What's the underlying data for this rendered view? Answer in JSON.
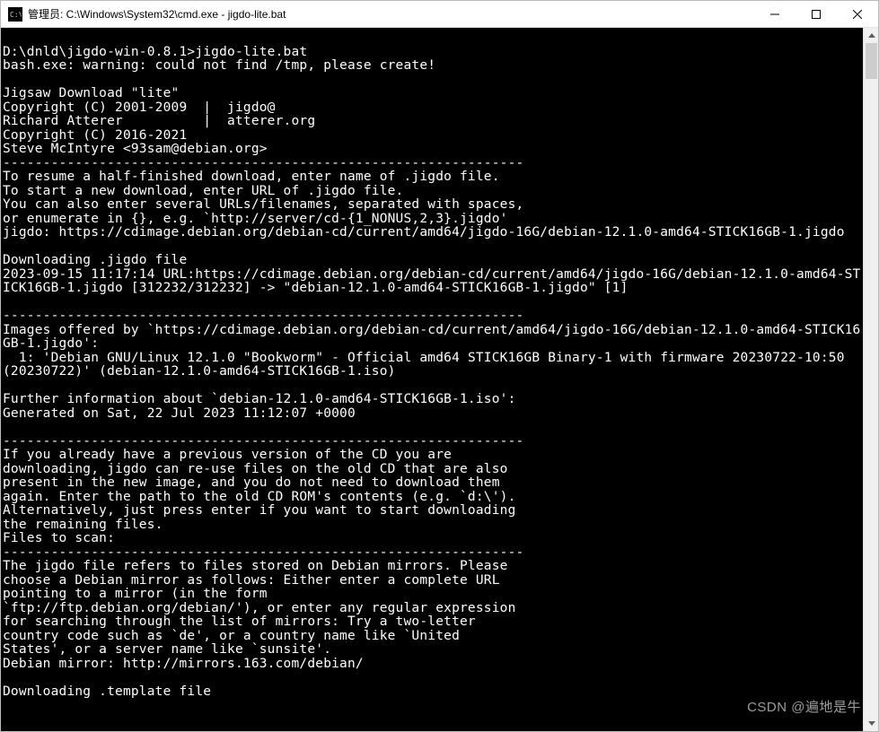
{
  "titlebar": {
    "icon_text": "C:\\",
    "title": "管理员: C:\\Windows\\System32\\cmd.exe - jigdo-lite.bat"
  },
  "console_text": "\nD:\\dnld\\jigdo-win-0.8.1>jigdo-lite.bat\nbash.exe: warning: could not find /tmp, please create!\n\nJigsaw Download \"lite\"\nCopyright (C) 2001-2009  |  jigdo@\nRichard Atterer          |  atterer.org\nCopyright (C) 2016-2021\nSteve McIntyre <93sam@debian.org>\n-----------------------------------------------------------------\nTo resume a half-finished download, enter name of .jigdo file.\nTo start a new download, enter URL of .jigdo file.\nYou can also enter several URLs/filenames, separated with spaces,\nor enumerate in {}, e.g. `http://server/cd-{1_NONUS,2,3}.jigdo'\njigdo: https://cdimage.debian.org/debian-cd/current/amd64/jigdo-16G/debian-12.1.0-amd64-STICK16GB-1.jigdo\n\nDownloading .jigdo file\n2023-09-15 11:17:14 URL:https://cdimage.debian.org/debian-cd/current/amd64/jigdo-16G/debian-12.1.0-amd64-STICK16GB-1.jigdo [312232/312232] -> \"debian-12.1.0-amd64-STICK16GB-1.jigdo\" [1]\n\n-----------------------------------------------------------------\nImages offered by `https://cdimage.debian.org/debian-cd/current/amd64/jigdo-16G/debian-12.1.0-amd64-STICK16GB-1.jigdo':\n  1: 'Debian GNU/Linux 12.1.0 \"Bookworm\" - Official amd64 STICK16GB Binary-1 with firmware 20230722-10:50 (20230722)' (debian-12.1.0-amd64-STICK16GB-1.iso)\n\nFurther information about `debian-12.1.0-amd64-STICK16GB-1.iso':\nGenerated on Sat, 22 Jul 2023 11:12:07 +0000\n\n-----------------------------------------------------------------\nIf you already have a previous version of the CD you are\ndownloading, jigdo can re-use files on the old CD that are also\npresent in the new image, and you do not need to download them\nagain. Enter the path to the old CD ROM's contents (e.g. `d:\\').\nAlternatively, just press enter if you want to start downloading\nthe remaining files.\nFiles to scan:\n-----------------------------------------------------------------\nThe jigdo file refers to files stored on Debian mirrors. Please\nchoose a Debian mirror as follows: Either enter a complete URL\npointing to a mirror (in the form\n`ftp://ftp.debian.org/debian/'), or enter any regular expression\nfor searching through the list of mirrors: Try a two-letter\ncountry code such as `de', or a country name like `United\nStates', or a server name like `sunsite'.\nDebian mirror: http://mirrors.163.com/debian/\n\nDownloading .template file",
  "watermark": "CSDN @遍地是牛"
}
